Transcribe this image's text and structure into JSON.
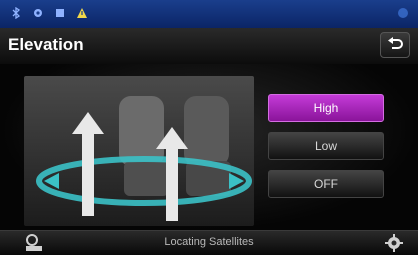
{
  "colors": {
    "status_bar": "#1a3e8c",
    "active_button": "#b02cc4",
    "background": "#000000"
  },
  "status_bar": {
    "icons": [
      "bluetooth-icon",
      "settings-icon",
      "wifi-icon",
      "warning-icon"
    ]
  },
  "header": {
    "title": "Elevation",
    "back_icon": "back-arrow-icon"
  },
  "options": {
    "selected": "High",
    "items": [
      {
        "label": "High"
      },
      {
        "label": "Low"
      },
      {
        "label": "OFF"
      }
    ]
  },
  "footer": {
    "left_icon": "navigation-icon",
    "status_text": "Locating Satellites",
    "right_icon": "gear-icon"
  }
}
